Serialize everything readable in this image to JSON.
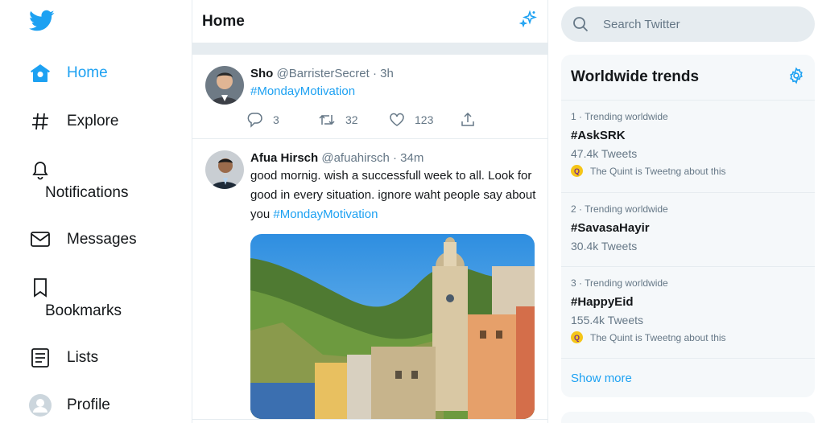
{
  "nav": {
    "items": [
      {
        "label": "Home",
        "icon": "home-icon",
        "active": true
      },
      {
        "label": "Explore",
        "icon": "hashtag-icon"
      },
      {
        "label": "Notifications",
        "icon": "bell-icon"
      },
      {
        "label": "Messages",
        "icon": "envelope-icon"
      },
      {
        "label": "Bookmarks",
        "icon": "bookmark-icon"
      },
      {
        "label": "Lists",
        "icon": "list-icon"
      },
      {
        "label": "Profile",
        "icon": "profile-icon"
      }
    ]
  },
  "header": {
    "title": "Home"
  },
  "tweets": [
    {
      "name": "Sho",
      "handle": "@BarristerSecret",
      "sep": "·",
      "time": "3h",
      "hashtag": "#MondayMotivation",
      "replies": "3",
      "retweets": "32",
      "likes": "123"
    },
    {
      "name": "Afua Hirsch",
      "handle": "@afuahirsch",
      "sep": "·",
      "time": "34m",
      "text": "good mornig. wish a successfull week to all. Look for good in every situation. ignore waht people say about you",
      "hashtag": "#MondayMotivation"
    }
  ],
  "search": {
    "placeholder": "Search Twitter"
  },
  "trends": {
    "title": "Worldwide trends",
    "items": [
      {
        "context": "1 · Trending worldwide",
        "name": "#AskSRK",
        "count": "47.4k Tweets",
        "about": "The Quint is Tweetng about this"
      },
      {
        "context": "2 · Trending worldwide",
        "name": "#SavasaHayir",
        "count": "30.4k Tweets"
      },
      {
        "context": "3 · Trending worldwide",
        "name": "#HappyEid",
        "count": "155.4k Tweets",
        "about": "The Quint is Tweetng about this"
      }
    ],
    "show_more": "Show more"
  },
  "colors": {
    "accent": "#1da1f2",
    "text": "#14171a",
    "muted": "#657786",
    "border": "#e6ecf0",
    "panel": "#f5f8fa"
  }
}
